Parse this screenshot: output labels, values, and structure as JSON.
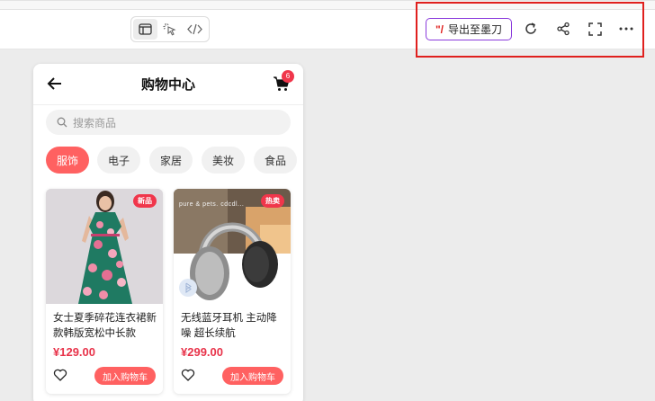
{
  "toolbar": {
    "view_modes": [
      {
        "name": "preview",
        "icon": "window-icon",
        "active": true
      },
      {
        "name": "select",
        "icon": "pointer-select-icon",
        "active": false
      },
      {
        "name": "code",
        "icon": "code-icon",
        "active": false
      }
    ],
    "export_label": "导出至墨刀",
    "export_logo": "\"/",
    "actions": [
      "refresh-icon",
      "share-icon",
      "fullscreen-icon",
      "more-icon"
    ],
    "highlight_color": "#e0201e"
  },
  "app": {
    "title": "购物中心",
    "cart_count": "6",
    "search_placeholder": "搜索商品",
    "categories": [
      {
        "label": "服饰",
        "active": true
      },
      {
        "label": "电子",
        "active": false
      },
      {
        "label": "家居",
        "active": false
      },
      {
        "label": "美妆",
        "active": false
      },
      {
        "label": "食品",
        "active": false
      }
    ],
    "products": [
      {
        "tag": "新品",
        "title": "女士夏季碎花连衣裙新款韩版宽松中长款",
        "price": "¥129.00",
        "button": "加入购物车"
      },
      {
        "tag": "热卖",
        "title": "无线蓝牙耳机 主动降噪 超长续航",
        "price": "¥299.00",
        "button": "加入购物车",
        "image_text": "pure & pets. cdcdl..."
      }
    ],
    "accent_color": "#ff6161",
    "price_color": "#e8334a"
  }
}
